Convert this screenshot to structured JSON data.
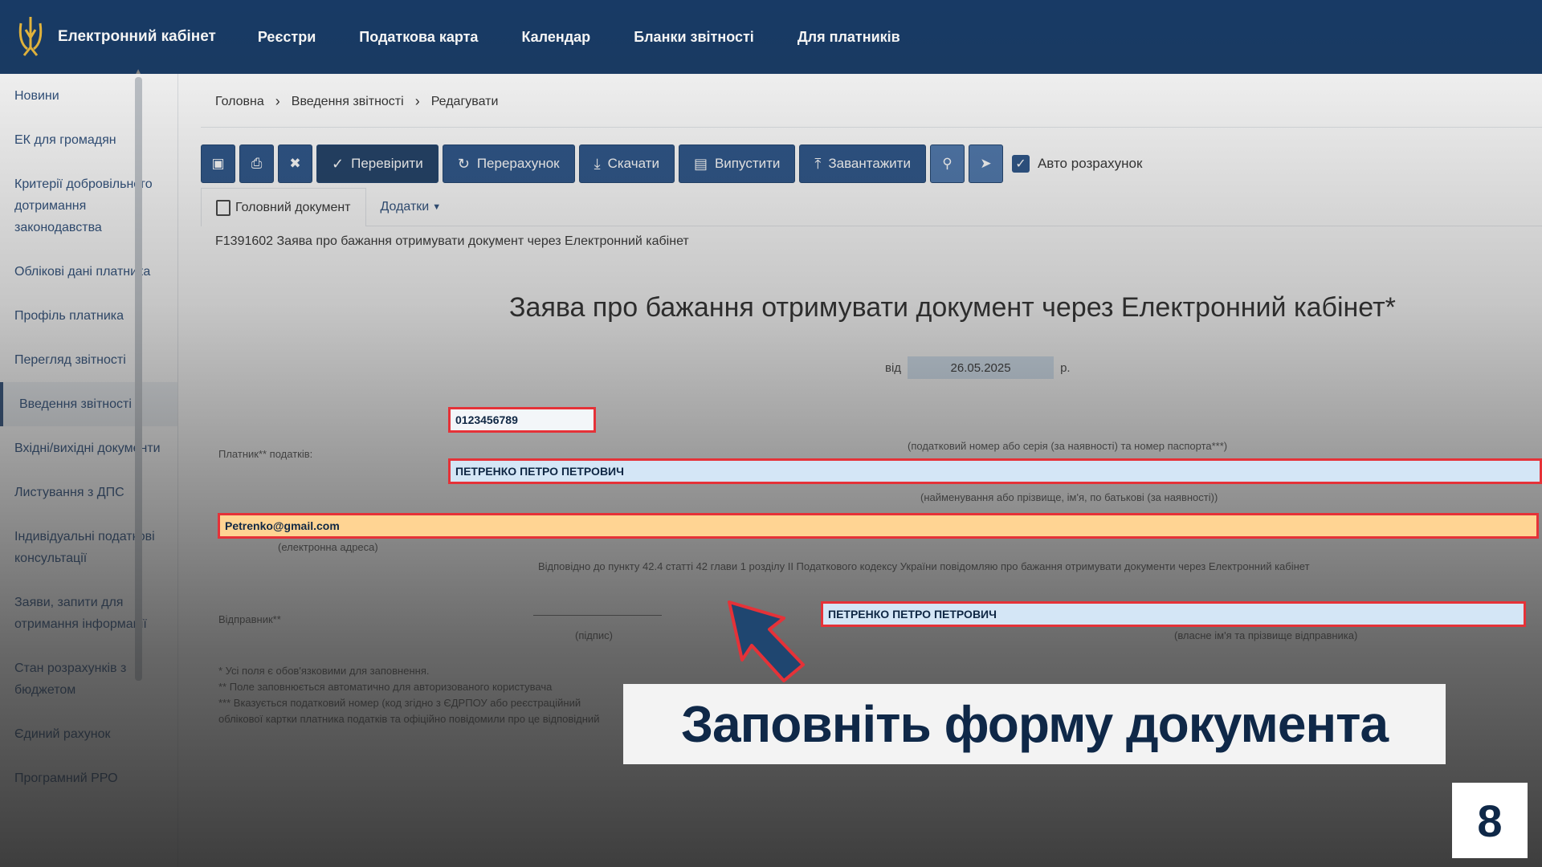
{
  "topbar": {
    "brand": "Електронний кабінет",
    "nav": [
      "Реєстри",
      "Податкова карта",
      "Календар",
      "Бланки звітності",
      "Для платників"
    ]
  },
  "sidebar": {
    "items": [
      "Новини",
      "ЕК для громадян",
      "Критерії добровільного дотримання законодавства",
      "Облікові дані платника",
      "Профіль платника",
      "Перегляд звітності",
      "Введення звітності",
      "Вхідні/вихідні документи",
      "Листування з ДПС",
      "Індивідуальні податкові консультації",
      "Заяви, запити для отримання інформації",
      "Стан розрахунків з бюджетом",
      "Єдиний рахунок",
      "Програмний РРО"
    ]
  },
  "breadcrumb": [
    "Головна",
    "Введення звітності",
    "Редагувати"
  ],
  "toolbar": {
    "check": "Перевірити",
    "recalc": "Перерахунок",
    "download": "Скачати",
    "issue": "Випустити",
    "upload": "Завантажити",
    "auto": "Авто розрахунок"
  },
  "tabs": {
    "main": "Головний документ",
    "annexes": "Додатки"
  },
  "doc_code": "F1391602 Заява про бажання отримувати документ через Електронний кабінет",
  "form": {
    "title": "Заява про бажання отримувати документ через Електронний кабінет*",
    "date_prefix": "від",
    "date": "26.05.2025",
    "date_suffix": "р.",
    "tax_id": "0123456789",
    "taxpayer_label": "Платник** податків:",
    "tax_id_hint": "(податковий номер або серія (за наявності) та номер паспорта***)",
    "full_name": "ПЕТРЕНКО ПЕТРО ПЕТРОВИЧ",
    "full_name_hint": "(найменування або прізвище, ім'я, по батькові (за наявності))",
    "email": "Petrenko@gmail.com",
    "email_hint": "(електронна адреса)",
    "statement": "Відповідно до пункту 42.4 статті 42 глави 1 розділу ІІ Податкового кодексу України повідомляю про бажання отримувати документи через Електронний кабінет",
    "sender_label": "Відправник**",
    "signature_hint": "(підпис)",
    "sender_name": "ПЕТРЕНКО ПЕТРО ПЕТРОВИЧ",
    "sender_name_hint": "(власне ім'я та прізвище відправника)",
    "footnote1": "* Усі поля є обов'язковими для заповнення.",
    "footnote2": "** Поле заповнюється автоматично для авторизованого користувача",
    "footnote3": "*** Вказується податковий номер (код згідно з ЄДРПОУ або реєстраційний",
    "footnote4": "облікової картки платника податків та офіційно повідомили про це відповідний"
  },
  "caption": "Заповніть форму документа",
  "page_number": "8"
}
